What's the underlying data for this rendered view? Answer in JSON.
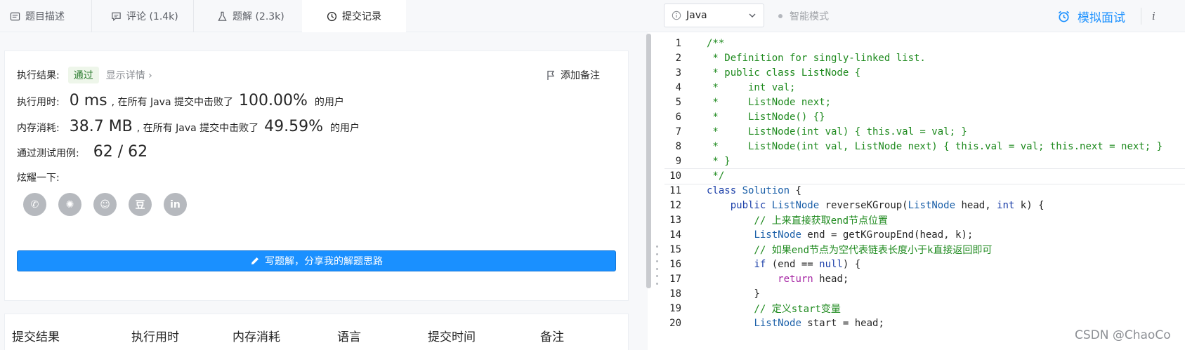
{
  "tabs": [
    {
      "label": "题目描述",
      "icon": "document-icon"
    },
    {
      "label": "评论 (1.4k)",
      "icon": "comment-icon"
    },
    {
      "label": "题解 (2.3k)",
      "icon": "flask-icon"
    },
    {
      "label": "提交记录",
      "icon": "clock-icon",
      "active": true
    }
  ],
  "toolbar": {
    "language": "Java",
    "smart_mode": "智能模式",
    "mock_interview": "模拟面试",
    "info": "i"
  },
  "result": {
    "result_label": "执行结果:",
    "status": "通过",
    "details": "显示详情",
    "add_note": "添加备注",
    "time_label": "执行用时:",
    "time_value": "0 ms",
    "time_mid": ", 在所有 Java 提交中击败了",
    "time_pct": "100.00%",
    "time_tail": "的用户",
    "mem_label": "内存消耗:",
    "mem_value": "38.7 MB",
    "mem_mid": ", 在所有 Java 提交中击败了",
    "mem_pct": "49.59%",
    "mem_tail": "的用户",
    "cases_label": "通过测试用例:",
    "cases_value": "62 / 62",
    "share_label": "炫耀一下:",
    "write_solution": "写题解，分享我的解题思路"
  },
  "share_icons": [
    {
      "name": "wechat-icon",
      "glyph": "✆"
    },
    {
      "name": "weibo-icon",
      "glyph": "✺"
    },
    {
      "name": "qq-icon",
      "glyph": "☺"
    },
    {
      "name": "douban-icon",
      "glyph": "豆"
    },
    {
      "name": "linkedin-icon",
      "glyph": "in"
    }
  ],
  "table_headers": [
    "提交结果",
    "执行用时",
    "内存消耗",
    "语言",
    "提交时间",
    "备注"
  ],
  "code_lines": [
    {
      "n": "1",
      "parts": [
        {
          "t": "/**",
          "c": "cm"
        }
      ]
    },
    {
      "n": "2",
      "parts": [
        {
          "t": " * Definition for singly-linked list.",
          "c": "cm"
        }
      ]
    },
    {
      "n": "3",
      "parts": [
        {
          "t": " * public class ListNode {",
          "c": "cm"
        }
      ]
    },
    {
      "n": "4",
      "parts": [
        {
          "t": " *     int val;",
          "c": "cm"
        }
      ]
    },
    {
      "n": "5",
      "parts": [
        {
          "t": " *     ListNode next;",
          "c": "cm"
        }
      ]
    },
    {
      "n": "6",
      "parts": [
        {
          "t": " *     ListNode() {}",
          "c": "cm"
        }
      ]
    },
    {
      "n": "7",
      "parts": [
        {
          "t": " *     ListNode(int val) { this.val = val; }",
          "c": "cm"
        }
      ]
    },
    {
      "n": "8",
      "parts": [
        {
          "t": " *     ListNode(int val, ListNode next) { this.val = val; this.next = next; }",
          "c": "cm"
        }
      ]
    },
    {
      "n": "9",
      "parts": [
        {
          "t": " * }",
          "c": "cm"
        }
      ]
    },
    {
      "n": "10",
      "parts": [
        {
          "t": " */",
          "c": "cm"
        }
      ],
      "current": true
    },
    {
      "n": "11",
      "parts": [
        {
          "t": "class ",
          "c": "kw"
        },
        {
          "t": "Solution",
          "c": "ty"
        },
        {
          "t": " {",
          "c": ""
        }
      ]
    },
    {
      "n": "12",
      "parts": [
        {
          "t": "    ",
          "c": ""
        },
        {
          "t": "public ",
          "c": "kw"
        },
        {
          "t": "ListNode",
          "c": "ty"
        },
        {
          "t": " reverseKGroup(",
          "c": ""
        },
        {
          "t": "ListNode",
          "c": "ty"
        },
        {
          "t": " head, ",
          "c": ""
        },
        {
          "t": "int",
          "c": "kw"
        },
        {
          "t": " k) {",
          "c": ""
        }
      ]
    },
    {
      "n": "13",
      "parts": [
        {
          "t": "        // 上来直接获取end节点位置",
          "c": "cm"
        }
      ]
    },
    {
      "n": "14",
      "parts": [
        {
          "t": "        ",
          "c": ""
        },
        {
          "t": "ListNode",
          "c": "ty"
        },
        {
          "t": " end = getKGroupEnd(head, k);",
          "c": ""
        }
      ]
    },
    {
      "n": "15",
      "parts": [
        {
          "t": "        // 如果end节点为空代表链表长度小于k直接返回即可",
          "c": "cm"
        }
      ]
    },
    {
      "n": "16",
      "parts": [
        {
          "t": "        ",
          "c": ""
        },
        {
          "t": "if",
          "c": "kw"
        },
        {
          "t": " (end == ",
          "c": ""
        },
        {
          "t": "null",
          "c": "lit"
        },
        {
          "t": ") {",
          "c": ""
        }
      ]
    },
    {
      "n": "17",
      "parts": [
        {
          "t": "            ",
          "c": ""
        },
        {
          "t": "return",
          "c": "ret"
        },
        {
          "t": " head;",
          "c": ""
        }
      ]
    },
    {
      "n": "18",
      "parts": [
        {
          "t": "        }",
          "c": ""
        }
      ]
    },
    {
      "n": "19",
      "parts": [
        {
          "t": "        // 定义start变量",
          "c": "cm"
        }
      ]
    },
    {
      "n": "20",
      "parts": [
        {
          "t": "        ",
          "c": ""
        },
        {
          "t": "ListNode",
          "c": "ty"
        },
        {
          "t": " start = head;",
          "c": ""
        }
      ]
    }
  ],
  "watermark": "CSDN @ChaoCo"
}
